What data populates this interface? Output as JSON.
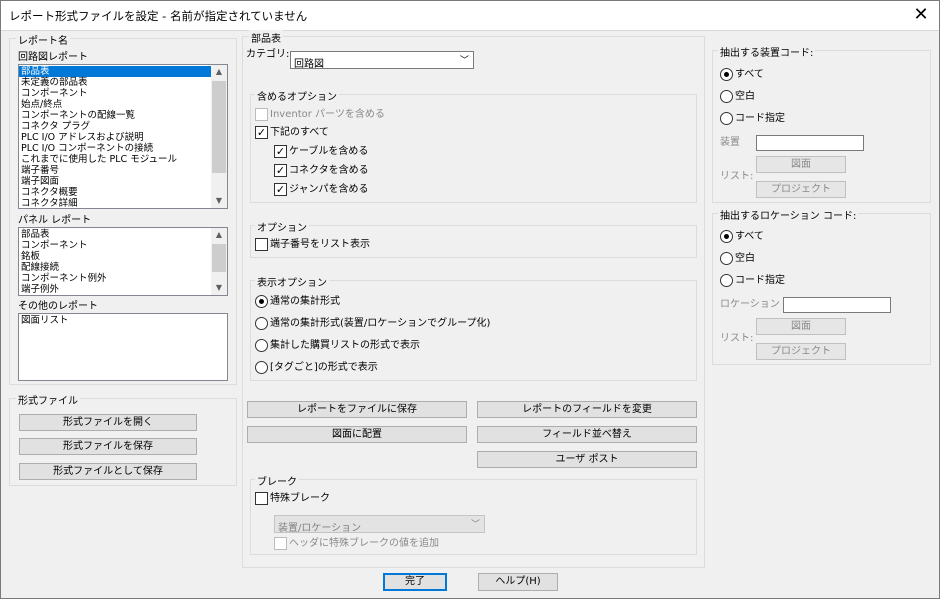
{
  "window": {
    "title": "レポート形式ファイルを設定 - 名前が指定されていません",
    "close_glyph": "✕"
  },
  "report_name": {
    "legend": "レポート名",
    "schematic": {
      "label": "回路図レポート",
      "items": [
        "部品表",
        "未定義の部品表",
        "コンポーネント",
        "始点/終点",
        "コンポーネントの配線一覧",
        "コネクタ プラグ",
        "PLC I/O アドレスおよび説明",
        "PLC I/O コンポーネントの接続",
        "これまでに使用した PLC モジュール",
        "端子番号",
        "端子図面",
        "コネクタ概要",
        "コネクタ詳細"
      ],
      "selected_index": 0
    },
    "panel": {
      "label": "パネル レポート",
      "items": [
        "部品表",
        "コンポーネント",
        "銘板",
        "配線接続",
        "コンポーネント例外",
        "端子例外"
      ]
    },
    "other": {
      "label": "その他のレポート",
      "items": [
        "図面リスト"
      ]
    }
  },
  "format_file": {
    "legend": "形式ファイル",
    "open": "形式ファイルを開く",
    "save": "形式ファイルを保存",
    "save_as": "形式ファイルとして保存"
  },
  "bom": {
    "legend": "部品表",
    "category_label": "カテゴリ:",
    "category_value": "回路図",
    "include": {
      "legend": "含めるオプション",
      "inventor": "Inventor パーツを含める",
      "all_below": "下記のすべて",
      "cables": "ケーブルを含める",
      "connectors": "コネクタを含める",
      "jumpers": "ジャンパを含める"
    },
    "options": {
      "legend": "オプション",
      "terminal_numbers": "端子番号をリスト表示"
    },
    "display": {
      "legend": "表示オプション",
      "choices": [
        "通常の集計形式",
        "通常の集計形式(装置/ロケーションでグループ化)",
        "集計した購買リストの形式で表示",
        "[タグごと]の形式で表示"
      ],
      "selected_index": 0
    },
    "buttons": {
      "save_to_file": "レポートをファイルに保存",
      "change_fields": "レポートのフィールドを変更",
      "place_on_drawing": "図面に配置",
      "field_sort": "フィールド並べ替え",
      "user_post": "ユーザ ポスト"
    },
    "break": {
      "legend": "ブレーク",
      "special": "特殊ブレーク",
      "combo": "装置/ロケーション",
      "header": "ヘッダに特殊ブレークの値を追加"
    }
  },
  "device_code": {
    "legend": "抽出する装置コード:",
    "choices": [
      "すべて",
      "空白",
      "コード指定"
    ],
    "selected_index": 0,
    "field_label": "装置",
    "field_value": "",
    "list_label": "リスト:",
    "drawing": "図面",
    "project": "プロジェクト"
  },
  "location_code": {
    "legend": "抽出するロケーション コード:",
    "choices": [
      "すべて",
      "空白",
      "コード指定"
    ],
    "selected_index": 0,
    "field_label": "ロケーション",
    "field_value": "",
    "list_label": "リスト:",
    "drawing": "図面",
    "project": "プロジェクト"
  },
  "footer": {
    "ok": "完了",
    "help": "ヘルプ(H)"
  }
}
